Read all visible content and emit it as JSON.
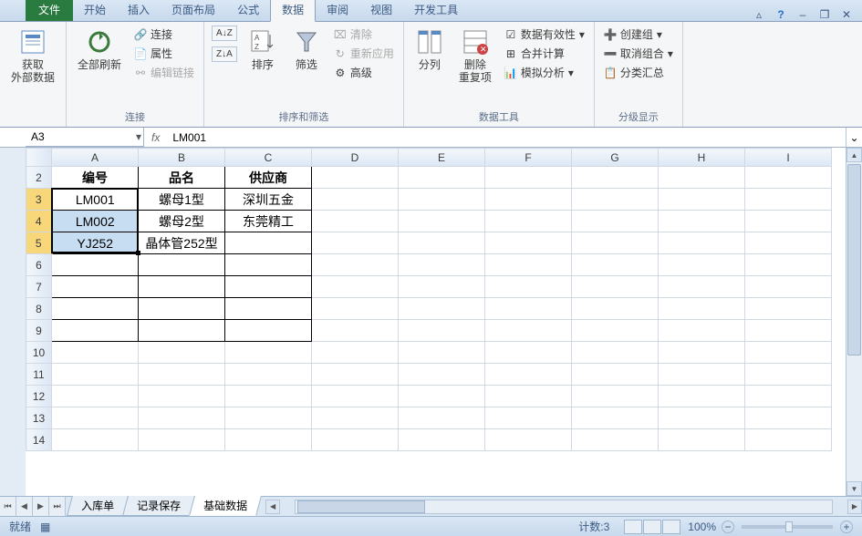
{
  "tabs": {
    "file": "文件",
    "items": [
      "开始",
      "插入",
      "页面布局",
      "公式",
      "数据",
      "审阅",
      "视图",
      "开发工具"
    ],
    "active": "数据"
  },
  "ribbon": {
    "groups": [
      {
        "label": "",
        "big": [
          {
            "name": "get-external-data",
            "label": "获取\n外部数据"
          }
        ],
        "small": []
      },
      {
        "label": "连接",
        "big": [
          {
            "name": "refresh-all",
            "label": "全部刷新"
          }
        ],
        "small": [
          {
            "name": "connections",
            "label": "连接"
          },
          {
            "name": "properties",
            "label": "属性"
          },
          {
            "name": "edit-links",
            "label": "编辑链接",
            "disabled": true
          }
        ]
      },
      {
        "label": "排序和筛选",
        "sortbtns": [
          "A→Z",
          "Z→A"
        ],
        "big": [
          {
            "name": "sort",
            "label": "排序"
          },
          {
            "name": "filter",
            "label": "筛选"
          }
        ],
        "small": [
          {
            "name": "clear",
            "label": "清除",
            "disabled": true
          },
          {
            "name": "reapply",
            "label": "重新应用",
            "disabled": true
          },
          {
            "name": "advanced",
            "label": "高级"
          }
        ]
      },
      {
        "label": "数据工具",
        "big": [
          {
            "name": "text-to-columns",
            "label": "分列"
          },
          {
            "name": "remove-duplicates",
            "label": "删除\n重复项"
          }
        ],
        "small": [
          {
            "name": "data-validation",
            "label": "数据有效性"
          },
          {
            "name": "consolidate",
            "label": "合并计算"
          },
          {
            "name": "what-if",
            "label": "模拟分析"
          }
        ]
      },
      {
        "label": "分级显示",
        "big": [],
        "small": [
          {
            "name": "group",
            "label": "创建组"
          },
          {
            "name": "ungroup",
            "label": "取消组合"
          },
          {
            "name": "subtotal",
            "label": "分类汇总"
          }
        ]
      }
    ]
  },
  "namebox": "A3",
  "formula": "LM001",
  "columns": [
    "A",
    "B",
    "C",
    "D",
    "E",
    "F",
    "G",
    "H",
    "I"
  ],
  "rows": [
    2,
    3,
    4,
    5,
    6,
    7,
    8,
    9,
    10,
    11,
    12,
    13,
    14
  ],
  "selected_rows": [
    3,
    4,
    5
  ],
  "active_cell": "A3",
  "table": {
    "headers": [
      "编号",
      "品名",
      "供应商"
    ],
    "data": [
      [
        "LM001",
        "螺母1型",
        "深圳五金"
      ],
      [
        "LM002",
        "螺母2型",
        "东莞精工"
      ],
      [
        "YJ252",
        "晶体管252型",
        ""
      ]
    ]
  },
  "sheets": {
    "items": [
      "入库单",
      "记录保存",
      "基础数据"
    ],
    "active": "基础数据"
  },
  "status": {
    "ready": "就绪",
    "count_label": "计数:",
    "count": 3,
    "zoom": "100%"
  }
}
